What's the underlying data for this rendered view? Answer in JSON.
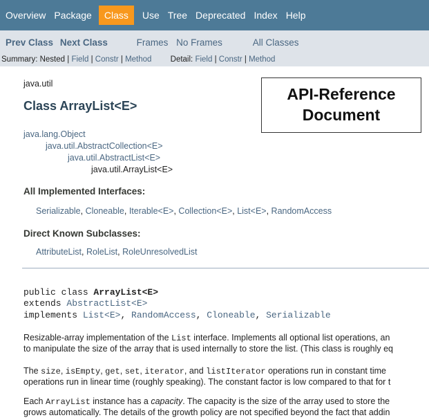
{
  "topnav": {
    "items": [
      "Overview",
      "Package",
      "Class",
      "Use",
      "Tree",
      "Deprecated",
      "Index",
      "Help"
    ],
    "active": "Class",
    "active_color": "#f8981d",
    "bar_color": "#4d7a97"
  },
  "subnav": {
    "prev_class": "Prev Class",
    "next_class": "Next Class",
    "frames": "Frames",
    "no_frames": "No Frames",
    "all_classes": "All Classes",
    "summary_label": "Summary:",
    "summary_nested": "Nested",
    "summary_field": "Field",
    "summary_constr": "Constr",
    "summary_method": "Method",
    "detail_label": "Detail:",
    "detail_field": "Field",
    "detail_constr": "Constr",
    "detail_method": "Method",
    "sep": "|"
  },
  "header": {
    "package": "java.util",
    "title": "Class ArrayList<E>"
  },
  "annotation": {
    "line1": "API-Reference",
    "line2": "Document"
  },
  "inheritance": [
    "java.lang.Object",
    "java.util.AbstractCollection<E>",
    "java.util.AbstractList<E>",
    "java.util.ArrayList<E>"
  ],
  "interfaces": {
    "title": "All Implemented Interfaces:",
    "items": [
      "Serializable",
      "Cloneable",
      "Iterable<E>",
      "Collection<E>",
      "List<E>",
      "RandomAccess"
    ]
  },
  "subclasses": {
    "title": "Direct Known Subclasses:",
    "items": [
      "AttributeList",
      "RoleList",
      "RoleUnresolvedList"
    ]
  },
  "signature": {
    "line1_prefix": "public class ",
    "line1_name": "ArrayList<E>",
    "line2_prefix": "extends ",
    "line2_link": "AbstractList<E>",
    "line3_prefix": "implements ",
    "line3_links": [
      "List<E>",
      "RandomAccess",
      "Cloneable",
      "Serializable"
    ]
  },
  "description": {
    "p1_a": "Resizable-array implementation of the ",
    "p1_code": "List",
    "p1_b": " interface. Implements all optional list operations, an",
    "p1_line2": "to manipulate the size of the array that is used internally to store the list. (This class is roughly eq",
    "p2_codes": [
      "size",
      "isEmpty",
      "get",
      "set",
      "iterator",
      "listIterator"
    ],
    "p2_a": "The ",
    "p2_b": " operations run in constant time",
    "p2_line2": "operations run in linear time (roughly speaking). The constant factor is low compared to that for t",
    "p3_a": "Each ",
    "p3_code": "ArrayList",
    "p3_b": " instance has a ",
    "p3_em": "capacity",
    "p3_c": ". The capacity is the size of the array used to store the",
    "p3_line2": "grows automatically. The details of the growth policy are not specified beyond the fact that addin"
  }
}
